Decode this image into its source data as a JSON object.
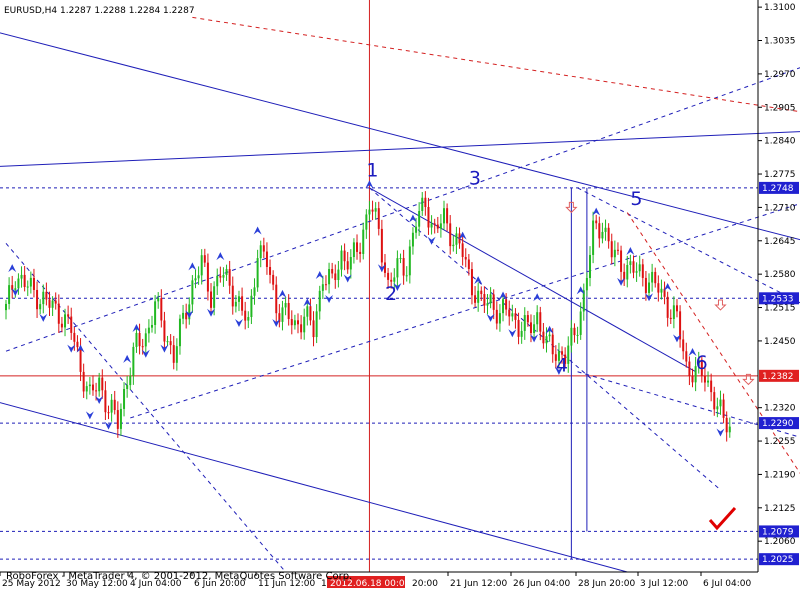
{
  "header": {
    "symbol": "EURUSD,H4",
    "ohlc": "1.2287 1.2288 1.2284 1.2287"
  },
  "footer": {
    "copyright": "RoboForex - MetaTrader 4, © 2001-2012, MetaQuotes Software Corp."
  },
  "colors": {
    "background": "#ffffff",
    "bull": "#22b822",
    "bear": "#dd1111",
    "trendline": "#1f1fb8",
    "level_line": "#1f1fb8",
    "red_line": "#d42020",
    "arrow_blue": "#2a3fd8",
    "arrow_red": "#e06060",
    "check_red": "#e00000"
  },
  "icons": {
    "signal_up": "blue-up-arrow-icon",
    "signal_down": "blue-down-arrow-icon",
    "target_down": "red-down-arrow-icon",
    "target_check": "red-checkmark-icon"
  },
  "chart_data": {
    "type": "candlestick",
    "symbol": "EURUSD",
    "timeframe": "H4",
    "ylim": [
      1.2,
      1.311
    ],
    "y_tick_labels": [
      "1.3100",
      "1.3035",
      "1.2970",
      "1.2905",
      "1.2840",
      "1.2775",
      "1.2710",
      "1.2645",
      "1.2580",
      "1.2515",
      "1.2450",
      "1.2320",
      "1.2255",
      "1.2190",
      "1.2125",
      "1.2060"
    ],
    "x_tick_labels": [
      "25 May 2012",
      "30 May 12:00",
      "4 Jun 04:00",
      "6 Jun 20:00",
      "11 Jun 12:00",
      "2012.06.18 00:00",
      "21 Jun 12:00",
      "26 Jun 04:00",
      "28 Jun 20:00",
      "3 Jul 12:00",
      "6 Jul 04:00"
    ],
    "x_tick_label_partial": [
      "1",
      "20:00"
    ],
    "highlighted_time_label": "2012.06.18 00:00",
    "price_markers": [
      {
        "price": 1.2748,
        "label": "1.2748",
        "line": "dashed-blue"
      },
      {
        "price": 1.2533,
        "label": "1.2533",
        "line": "dashed-blue"
      },
      {
        "price": 1.2382,
        "label": "1.2382",
        "line": "solid-red",
        "highlight": true
      },
      {
        "price": 1.229,
        "label": "1.2290",
        "line": "dashed-blue"
      },
      {
        "price": 1.2079,
        "label": "1.2079",
        "line": "dashed-blue"
      },
      {
        "price": 1.2025,
        "label": "1.2025",
        "line": "dashed-blue"
      }
    ],
    "wave_labels": [
      {
        "label": "1",
        "x_candle": 116,
        "price": 1.277
      },
      {
        "label": "2",
        "x_candle": 122,
        "price": 1.253
      },
      {
        "label": "3",
        "x_candle": 149,
        "price": 1.2755
      },
      {
        "label": "4",
        "x_candle": 177,
        "price": 1.239
      },
      {
        "label": "5",
        "x_candle": 201,
        "price": 1.2715
      },
      {
        "label": "6",
        "x_candle": 222,
        "price": 1.2395
      }
    ],
    "series": [
      {
        "type": "ohlc_close_path",
        "points": [
          [
            0,
            1.251
          ],
          [
            3,
            1.258
          ],
          [
            6,
            1.256
          ],
          [
            9,
            1.2545
          ],
          [
            12,
            1.253
          ],
          [
            15,
            1.2515
          ],
          [
            18,
            1.25
          ],
          [
            21,
            1.247
          ],
          [
            24,
            1.24
          ],
          [
            27,
            1.234
          ],
          [
            30,
            1.237
          ],
          [
            33,
            1.232
          ],
          [
            36,
            1.229
          ],
          [
            39,
            1.238
          ],
          [
            42,
            1.244
          ],
          [
            45,
            1.246
          ],
          [
            48,
            1.252
          ],
          [
            51,
            1.247
          ],
          [
            54,
            1.242
          ],
          [
            57,
            1.249
          ],
          [
            60,
            1.256
          ],
          [
            63,
            1.26
          ],
          [
            66,
            1.254
          ],
          [
            69,
            1.258
          ],
          [
            72,
            1.256
          ],
          [
            75,
            1.252
          ],
          [
            78,
            1.248
          ],
          [
            81,
            1.263
          ],
          [
            84,
            1.26
          ],
          [
            87,
            1.252
          ],
          [
            90,
            1.25
          ],
          [
            93,
            1.248
          ],
          [
            96,
            1.25
          ],
          [
            99,
            1.247
          ],
          [
            102,
            1.258
          ],
          [
            105,
            1.256
          ],
          [
            108,
            1.262
          ],
          [
            111,
            1.26
          ],
          [
            114,
            1.264
          ],
          [
            117,
            1.272
          ],
          [
            120,
            1.266
          ],
          [
            123,
            1.256
          ],
          [
            126,
            1.259
          ],
          [
            129,
            1.26
          ],
          [
            132,
            1.268
          ],
          [
            135,
            1.272
          ],
          [
            138,
            1.266
          ],
          [
            141,
            1.269
          ],
          [
            144,
            1.265
          ],
          [
            147,
            1.262
          ],
          [
            150,
            1.256
          ],
          [
            153,
            1.252
          ],
          [
            156,
            1.253
          ],
          [
            159,
            1.25
          ],
          [
            162,
            1.251
          ],
          [
            165,
            1.248
          ],
          [
            168,
            1.247
          ],
          [
            171,
            1.25
          ],
          [
            174,
            1.244
          ],
          [
            177,
            1.243
          ],
          [
            180,
            1.242
          ],
          [
            183,
            1.246
          ],
          [
            186,
            1.254
          ],
          [
            189,
            1.266
          ],
          [
            192,
            1.268
          ],
          [
            195,
            1.262
          ],
          [
            198,
            1.26
          ],
          [
            201,
            1.259
          ],
          [
            204,
            1.258
          ],
          [
            207,
            1.257
          ],
          [
            210,
            1.255
          ],
          [
            213,
            1.252
          ],
          [
            216,
            1.249
          ],
          [
            219,
            1.24
          ],
          [
            222,
            1.239
          ],
          [
            225,
            1.238
          ],
          [
            228,
            1.234
          ],
          [
            231,
            1.229
          ],
          [
            233,
            1.2287
          ]
        ]
      }
    ]
  }
}
